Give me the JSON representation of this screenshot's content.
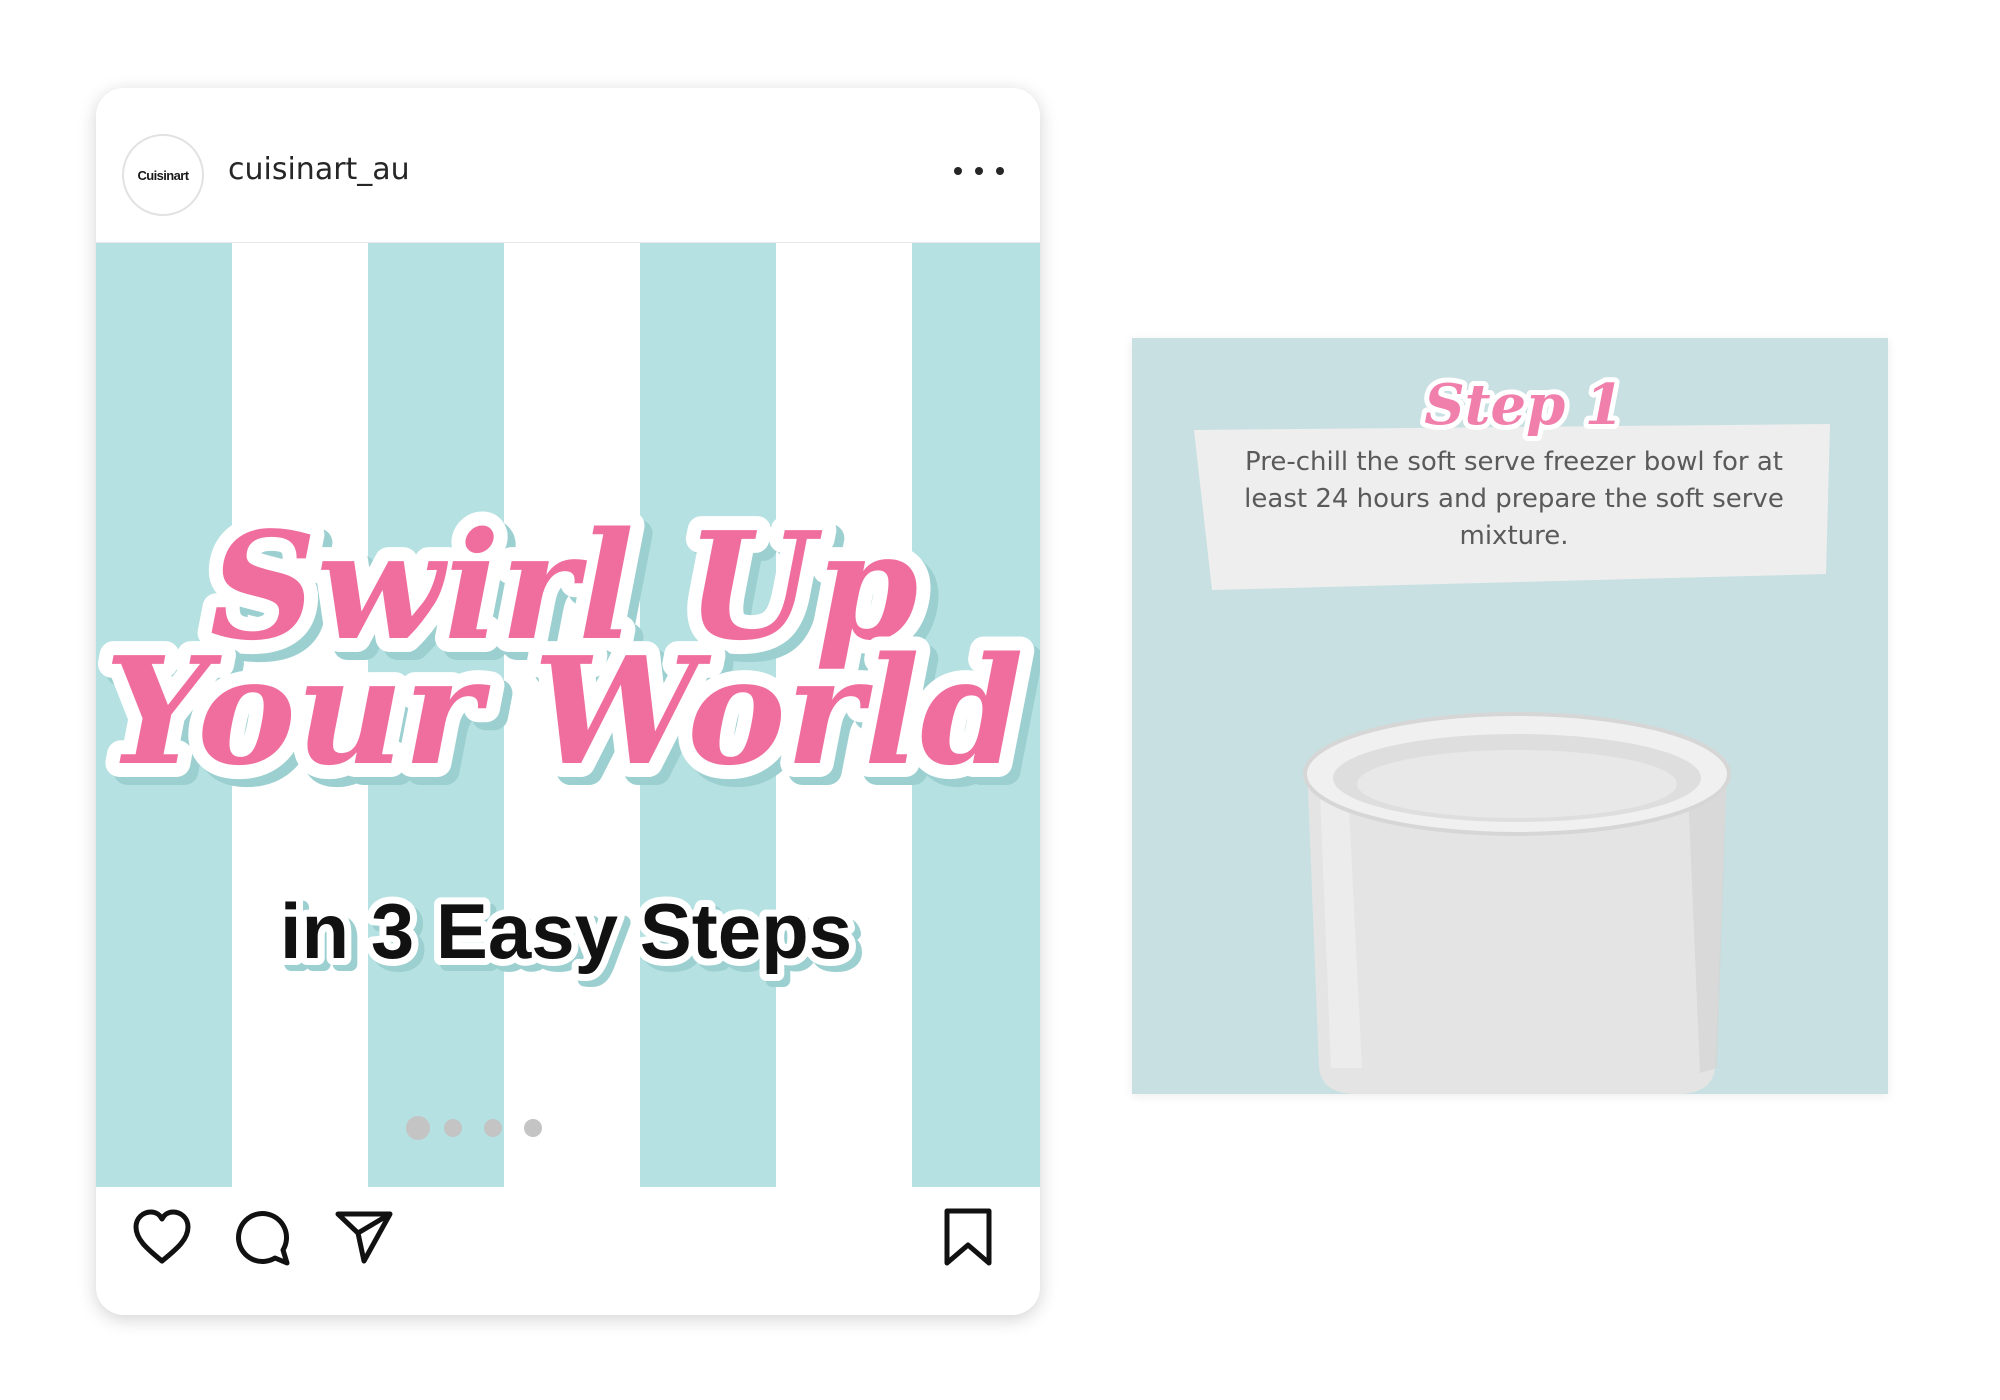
{
  "post": {
    "avatar_text": "Cuisinart",
    "username": "cuisinart_au",
    "headline_line1": "Swirl Up",
    "headline_line2": "Your World",
    "headline_line3": "in 3 Easy Steps",
    "carousel": {
      "total": 4,
      "active": 1
    }
  },
  "slide": {
    "step_title": "Step 1",
    "description": "Pre-chill the soft serve freezer bowl for at least 24 hours and prepare the soft serve mixture."
  },
  "colors": {
    "stripe_teal": "#b6e1e2",
    "headline_pink": "#f06e9e",
    "slide_bg": "#c8e0e2"
  },
  "icons": [
    "more-icon",
    "heart-icon",
    "comment-icon",
    "share-icon",
    "bookmark-icon"
  ]
}
